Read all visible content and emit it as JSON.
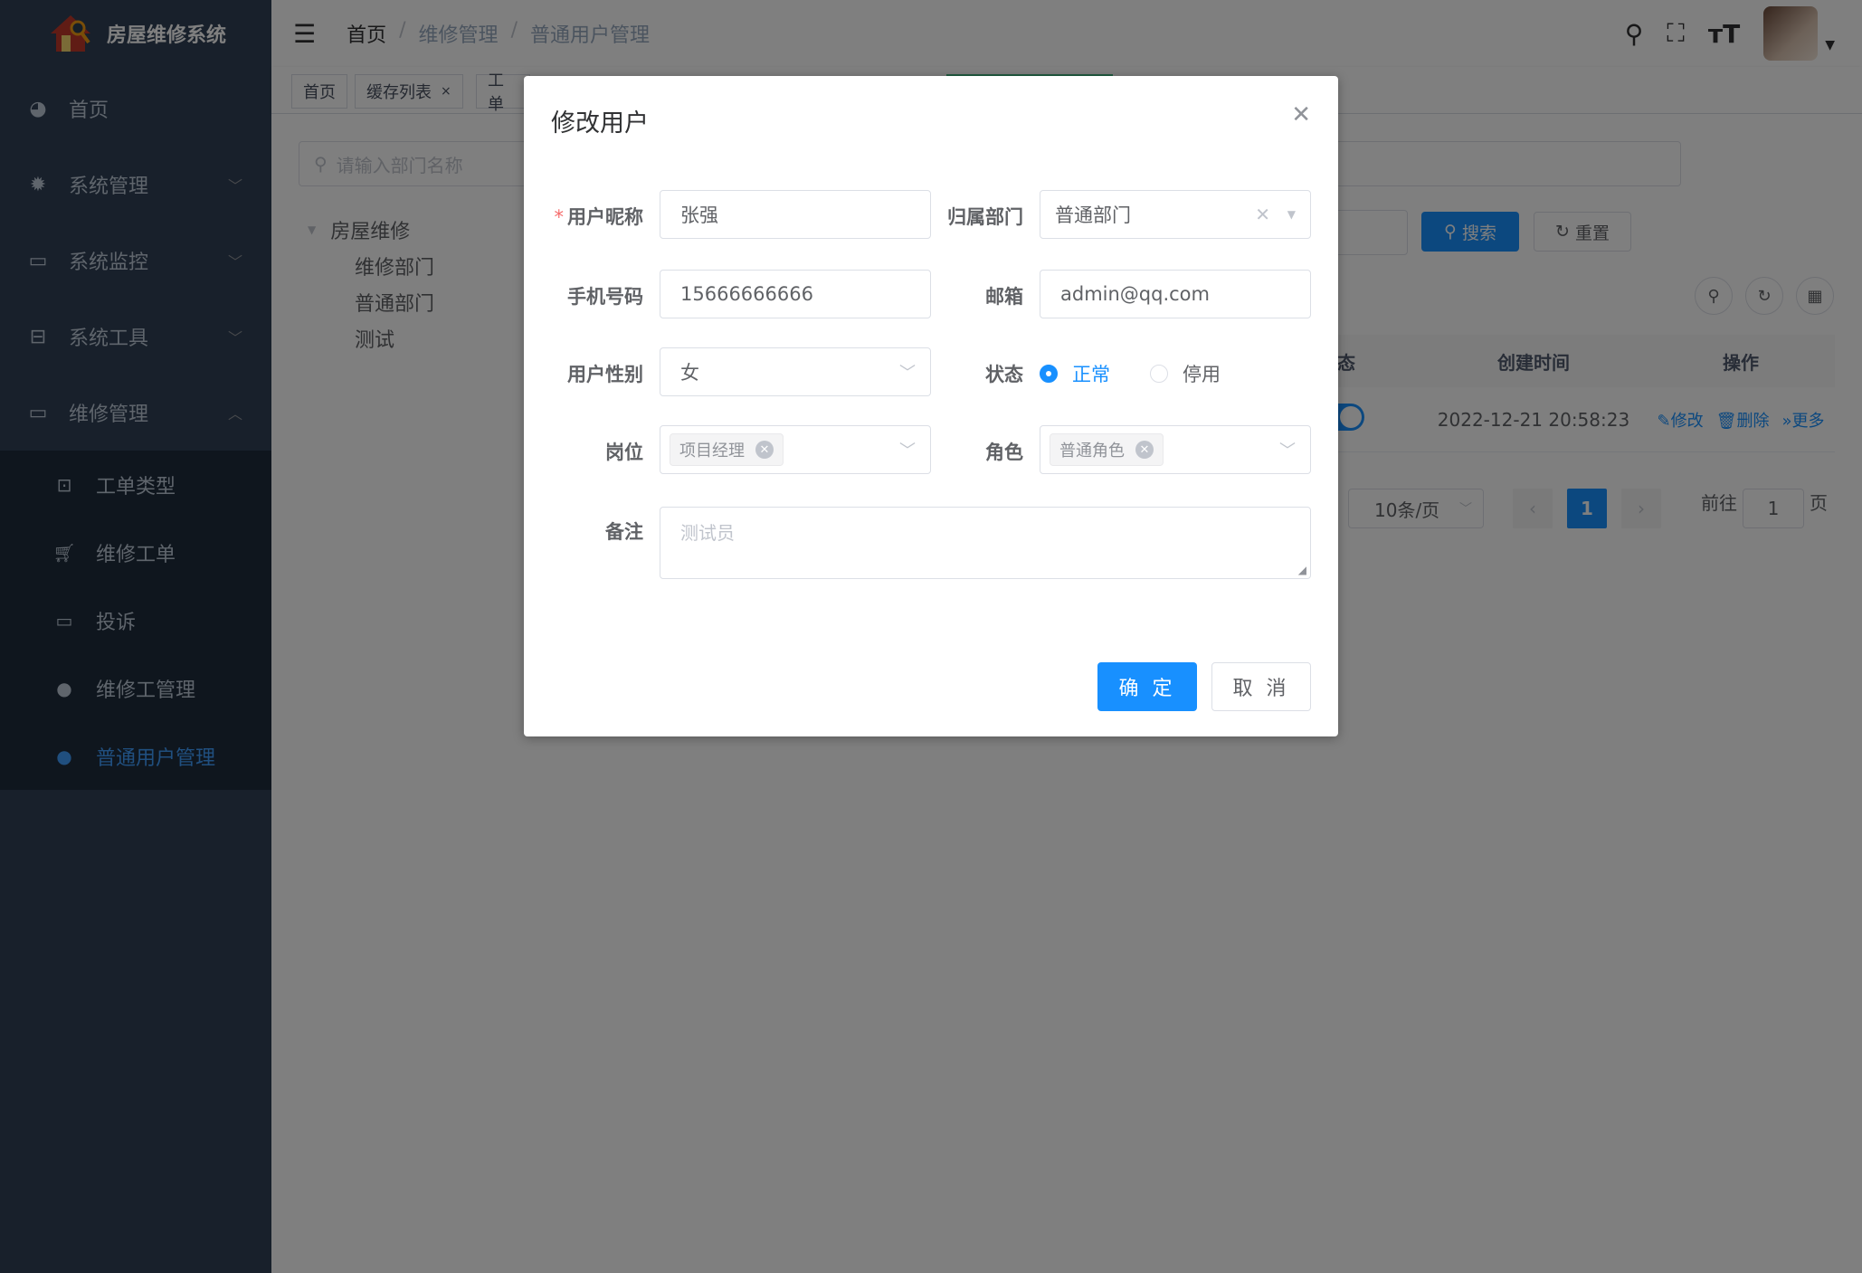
{
  "app": {
    "title": "房屋维修系统"
  },
  "sidebar": {
    "items": [
      {
        "label": "首页",
        "icon": "dashboard-icon"
      },
      {
        "label": "系统管理",
        "icon": "gear-icon"
      },
      {
        "label": "系统监控",
        "icon": "monitor-icon"
      },
      {
        "label": "系统工具",
        "icon": "toolbox-icon"
      },
      {
        "label": "维修管理",
        "icon": "monitor-icon"
      }
    ],
    "subitems": [
      {
        "label": "工单类型",
        "icon": "briefcase-icon"
      },
      {
        "label": "维修工单",
        "icon": "cart-icon"
      },
      {
        "label": "投诉",
        "icon": "monitor-icon"
      },
      {
        "label": "维修工管理",
        "icon": "user-icon"
      },
      {
        "label": "普通用户管理",
        "icon": "user-icon"
      }
    ]
  },
  "header": {
    "breadcrumb": [
      "首页",
      "维修管理",
      "普通用户管理"
    ]
  },
  "tags": [
    {
      "label": "首页"
    },
    {
      "label": "缓存列表"
    },
    {
      "label": "工单"
    }
  ],
  "content": {
    "dept_search_placeholder": "请输入部门名称",
    "tree": {
      "root": "房屋维修",
      "children": [
        "维修部门",
        "普通部门",
        "测试"
      ]
    },
    "search_button": "搜索",
    "reset_button": "重置",
    "table": {
      "columns": [
        "态",
        "创建时间",
        "操作"
      ],
      "rows": [
        {
          "created": "2022-12-21 20:58:23",
          "edit": "修改",
          "delete": "删除",
          "more": "更多"
        }
      ]
    },
    "pagination": {
      "page_size": "10条/页",
      "current": "1",
      "goto_label": "前往",
      "goto_value": "1",
      "page_suffix": "页"
    }
  },
  "dialog": {
    "title": "修改用户",
    "fields": {
      "nickname": {
        "label": "用户昵称",
        "value": "张强"
      },
      "dept": {
        "label": "归属部门",
        "value": "普通部门"
      },
      "phone": {
        "label": "手机号码",
        "value": "15666666666"
      },
      "email": {
        "label": "邮箱",
        "value": "admin@qq.com"
      },
      "gender": {
        "label": "用户性别",
        "value": "女"
      },
      "status": {
        "label": "状态",
        "options": [
          "正常",
          "停用"
        ],
        "selected": "正常"
      },
      "post": {
        "label": "岗位",
        "tag": "项目经理"
      },
      "role": {
        "label": "角色",
        "tag": "普通角色"
      },
      "remark": {
        "label": "备注",
        "placeholder": "测试员"
      }
    },
    "ok_button": "确 定",
    "cancel_button": "取 消"
  },
  "colors": {
    "primary": "#1890ff",
    "sidebar_bg": "#304156",
    "submenu_bg": "#1f2d3d"
  }
}
